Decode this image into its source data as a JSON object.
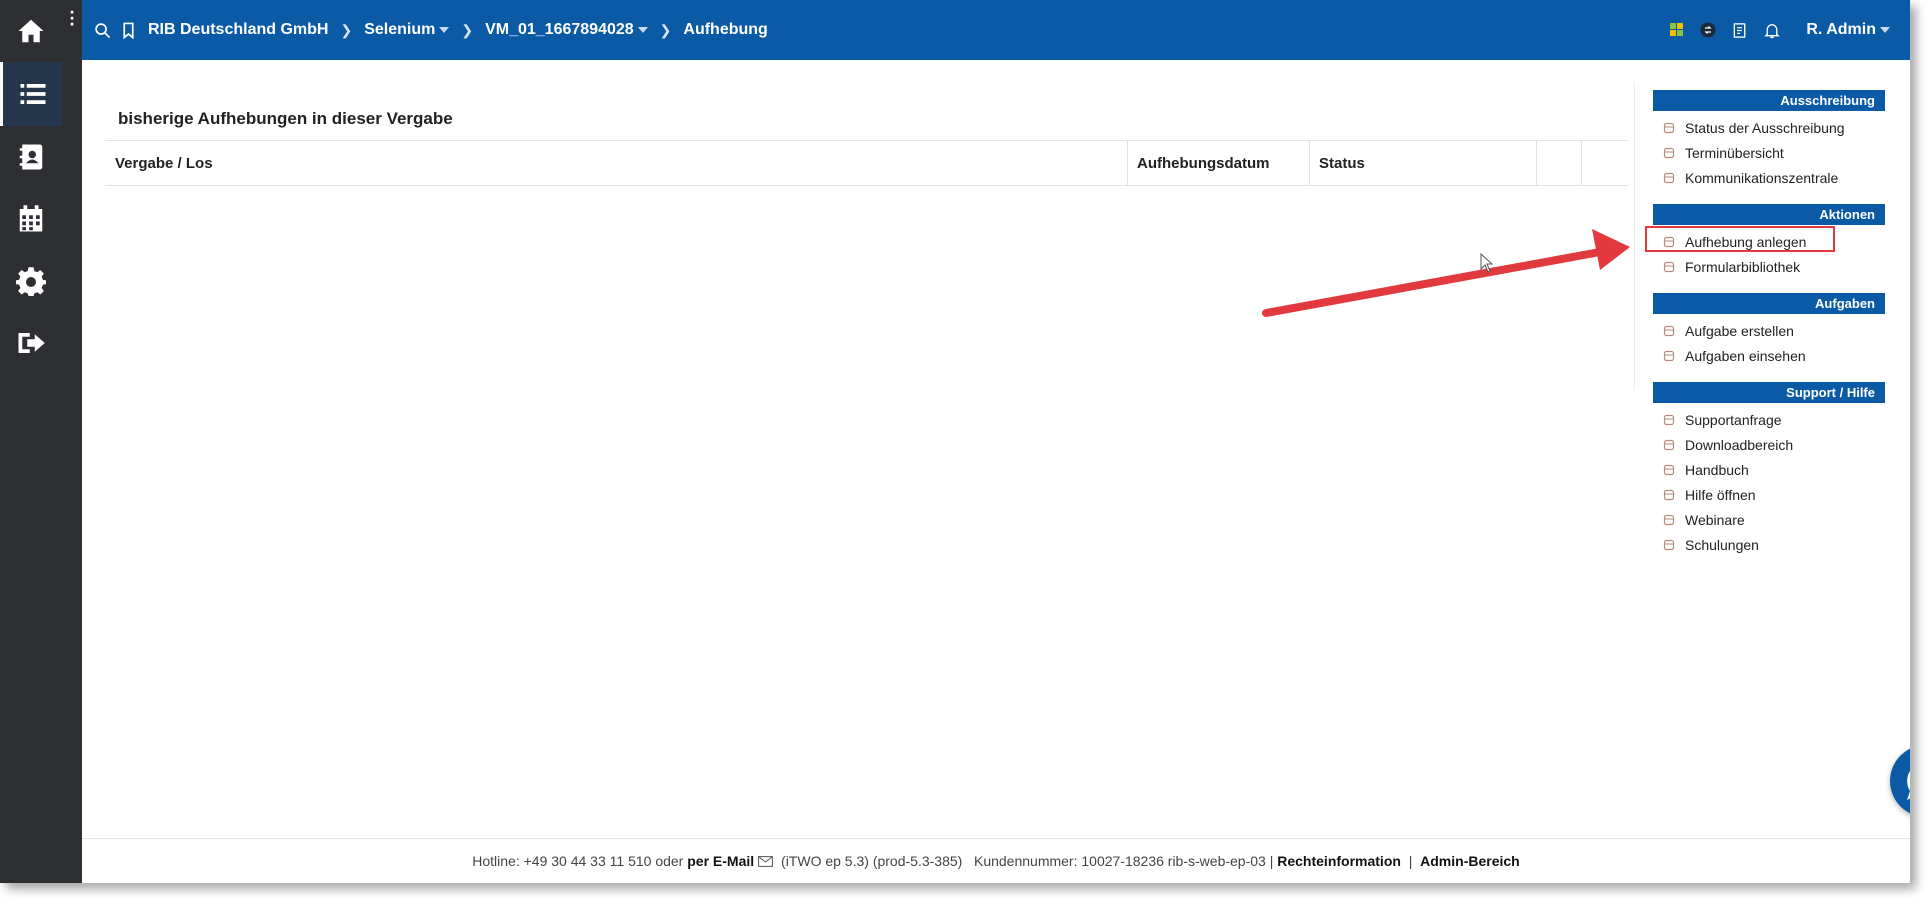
{
  "header": {
    "breadcrumbs": [
      {
        "label": "RIB Deutschland GmbH",
        "has_dropdown": false
      },
      {
        "label": "Selenium",
        "has_dropdown": true
      },
      {
        "label": "VM_01_1667894028",
        "has_dropdown": true
      },
      {
        "label": "Aufhebung",
        "has_dropdown": false
      }
    ],
    "user_name": "R. Admin"
  },
  "sidebar": {
    "items": [
      {
        "icon": "home-icon",
        "active": false
      },
      {
        "icon": "list-icon",
        "active": true
      },
      {
        "icon": "address-book-icon",
        "active": false
      },
      {
        "icon": "calendar-icon",
        "active": false
      },
      {
        "icon": "gear-icon",
        "active": false
      },
      {
        "icon": "sign-out-icon",
        "active": false
      }
    ]
  },
  "main": {
    "section_title": "bisherige Aufhebungen in dieser Vergabe",
    "table": {
      "columns": [
        "Vergabe / Los",
        "Aufhebungsdatum",
        "Status",
        "",
        ""
      ],
      "rows": []
    }
  },
  "right_panel": {
    "sections": [
      {
        "title": "Ausschreibung",
        "items": [
          "Status der Ausschreibung",
          "Terminübersicht",
          "Kommunikationszentrale"
        ]
      },
      {
        "title": "Aktionen",
        "items": [
          "Aufhebung anlegen",
          "Formularbibliothek"
        ]
      },
      {
        "title": "Aufgaben",
        "items": [
          "Aufgabe erstellen",
          "Aufgaben einsehen"
        ]
      },
      {
        "title": "Support / Hilfe",
        "items": [
          "Supportanfrage",
          "Downloadbereich",
          "Handbuch",
          "Hilfe öffnen",
          "Webinare",
          "Schulungen"
        ]
      }
    ],
    "highlighted_item": "Aufhebung anlegen"
  },
  "footer": {
    "hotline": "Hotline: +49 30 44 33 11 510 oder ",
    "email_link": "per E-Mail",
    "version": " (iTWO ep 5.3) (prod-5.3-385)   Kundennummer: 10027-18236 rib-s-web-ep-03 | ",
    "legal_link": "Rechteinformation",
    "separator": "  |  ",
    "admin_link": "Admin-Bereich"
  },
  "colors": {
    "brand_blue": "#0a5aa5",
    "sidebar_dark": "#2d2f33",
    "annotation_red": "#e2393f"
  }
}
